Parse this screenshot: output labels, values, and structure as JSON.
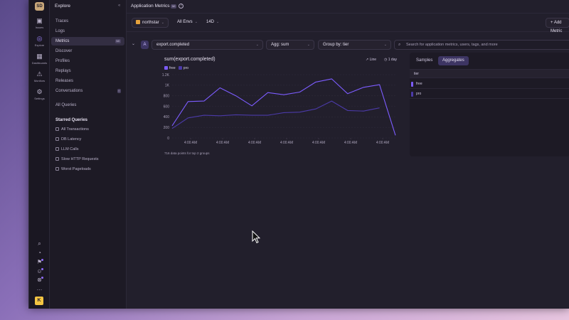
{
  "rail": {
    "org_initials": "SD",
    "items": [
      {
        "icon": "inbox-icon",
        "glyph": "▣",
        "label": "Issues"
      },
      {
        "icon": "compass-icon",
        "glyph": "◎",
        "label": "Explore"
      },
      {
        "icon": "dashboards-icon",
        "glyph": "▦",
        "label": "Dashboards"
      },
      {
        "icon": "siren-icon",
        "glyph": "⚠",
        "label": "Monitors"
      },
      {
        "icon": "gear-icon",
        "glyph": "⚙",
        "label": "Settings"
      }
    ],
    "user_initial": "K"
  },
  "nav": {
    "header": "Explore",
    "items": [
      {
        "label": "Traces"
      },
      {
        "label": "Logs"
      },
      {
        "label": "Metrics",
        "badge": "MI"
      },
      {
        "label": "Discover"
      },
      {
        "label": "Profiles"
      },
      {
        "label": "Replays"
      },
      {
        "label": "Releases"
      },
      {
        "label": "Conversations"
      }
    ],
    "all_queries": "All Queries",
    "starred_title": "Starred Queries",
    "starred": [
      "All Transactions",
      "DB Latency",
      "LLM Calls",
      "Slow HTTP Requests",
      "Worst Pageloads"
    ]
  },
  "header": {
    "title": "Application Metrics",
    "badge": "MI"
  },
  "filters": {
    "project": "northstar",
    "env": "All Envs",
    "period": "14D",
    "add_metric": "+ Add Metric",
    "add_other": "+ A"
  },
  "query": {
    "letter": "A",
    "metric": "export.completed",
    "agg_label": "Agg:",
    "agg_value": "sum",
    "group_label": "Group by:",
    "group_value": "tier",
    "search_placeholder": "Search for application metrics, users, tags, and more"
  },
  "chart_panel": {
    "title": "sum(export.completed)",
    "display": "Line",
    "interval": "1 day",
    "footer": "716 data points for top 2 groups"
  },
  "side_panel": {
    "tabs": [
      "Samples",
      "Aggregates"
    ],
    "column": "tier",
    "rows": [
      {
        "label": "free",
        "color": "#7c5cff"
      },
      {
        "label": "pro",
        "color": "#4b3aa8"
      }
    ]
  },
  "chart_data": {
    "type": "line",
    "x": [
      "4:00 AM",
      "4:00 AM",
      "4:00 AM",
      "4:00 AM",
      "4:00 AM",
      "4:00 AM",
      "4:00 AM"
    ],
    "yticks": [
      "0",
      "200",
      "400",
      "600",
      "800",
      "1K",
      "1.2K"
    ],
    "ylim": [
      0,
      1200
    ],
    "series": [
      {
        "name": "free",
        "color": "#7c5cff",
        "values": [
          230,
          690,
          700,
          950,
          800,
          610,
          860,
          820,
          870,
          1060,
          1120,
          840,
          960,
          1010,
          50
        ]
      },
      {
        "name": "pro",
        "color": "#4b3aa8",
        "values": [
          180,
          380,
          430,
          420,
          440,
          430,
          430,
          480,
          490,
          550,
          700,
          520,
          510,
          570,
          null
        ]
      }
    ]
  }
}
